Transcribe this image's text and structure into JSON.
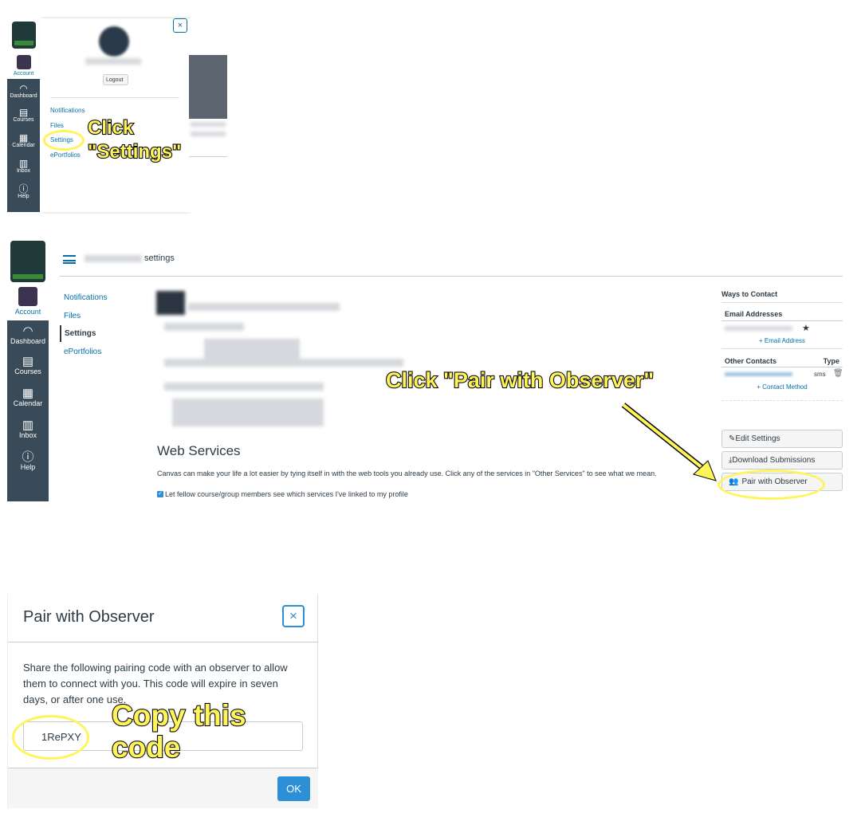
{
  "sidebar": {
    "items": [
      {
        "label": "Account",
        "icon": "avatar"
      },
      {
        "label": "Dashboard",
        "icon": "dashboard-icon"
      },
      {
        "label": "Courses",
        "icon": "courses-icon"
      },
      {
        "label": "Calendar",
        "icon": "calendar-icon"
      },
      {
        "label": "Inbox",
        "icon": "inbox-icon"
      },
      {
        "label": "Help",
        "icon": "help-icon"
      }
    ]
  },
  "step1": {
    "close": "×",
    "logout": "Logout",
    "links": [
      "Notifications",
      "Files",
      "Settings",
      "ePortfolios"
    ],
    "callout": [
      "Click",
      "\"Settings\""
    ]
  },
  "step2": {
    "title": "settings",
    "nav": [
      "Notifications",
      "Files",
      "Settings",
      "ePortfolios"
    ],
    "web_services_title": "Web Services",
    "web_services_text": "Canvas can make your life a lot easier by tying itself in with the web tools you already use. Click any of the services in \"Other Services\" to see what we mean.",
    "checkbox_label": "Let fellow course/group members see which services I've linked to my profile",
    "ways_title": "Ways to Contact",
    "email_header": "Email Addresses",
    "add_email": "+ Email Address",
    "other_header": "Other Contacts",
    "type_header": "Type",
    "contact_type": "sms",
    "add_contact": "+ Contact Method",
    "edit_settings": "Edit Settings",
    "download": "Download Submissions",
    "pair": "Pair with Observer",
    "callout": "Click \"Pair with Observer\""
  },
  "step3": {
    "title": "Pair with Observer",
    "close": "×",
    "body": "Share the following pairing code with an observer to allow them to connect with you. This code will expire in seven days, or after one use.",
    "code": "1RePXY",
    "ok": "OK",
    "callout": [
      "Copy this",
      "code"
    ]
  },
  "colors": {
    "sidebar": "#394b58",
    "link": "#0770a3",
    "highlight": "#fff45a",
    "ok": "#2d8fd5"
  }
}
